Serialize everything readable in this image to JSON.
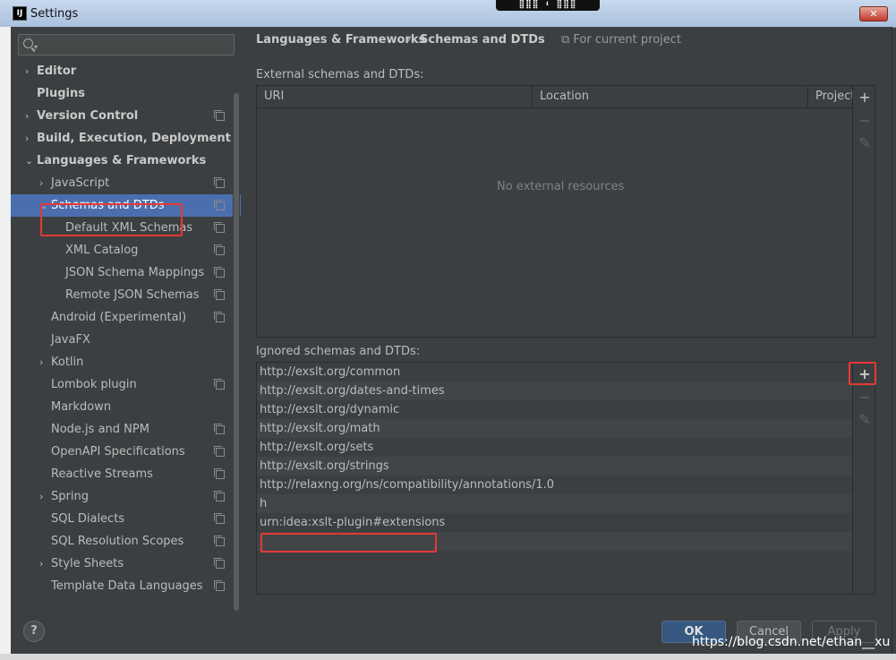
{
  "window": {
    "title": "Settings",
    "app_icon": "IJ",
    "close_label": "✕",
    "top_indicator": "⣿⣿⣿ ⬇ ⣿⣿⣿"
  },
  "sidebar": {
    "search_placeholder": "",
    "items": [
      {
        "label": "Editor",
        "level": 0,
        "arrow": "›",
        "bold": true,
        "project": false
      },
      {
        "label": "Plugins",
        "level": 0,
        "arrow": "",
        "bold": true,
        "project": false
      },
      {
        "label": "Version Control",
        "level": 0,
        "arrow": "›",
        "bold": true,
        "project": true
      },
      {
        "label": "Build, Execution, Deployment",
        "level": 0,
        "arrow": "›",
        "bold": true,
        "project": false
      },
      {
        "label": "Languages & Frameworks",
        "level": 0,
        "arrow": "⌄",
        "bold": true,
        "project": false
      },
      {
        "label": "JavaScript",
        "level": 1,
        "arrow": "›",
        "bold": false,
        "project": true
      },
      {
        "label": "Schemas and DTDs",
        "level": 1,
        "arrow": "⌄",
        "bold": false,
        "project": true,
        "selected": true
      },
      {
        "label": "Default XML Schemas",
        "level": 2,
        "arrow": "",
        "bold": false,
        "project": true
      },
      {
        "label": "XML Catalog",
        "level": 2,
        "arrow": "",
        "bold": false,
        "project": true
      },
      {
        "label": "JSON Schema Mappings",
        "level": 2,
        "arrow": "",
        "bold": false,
        "project": true
      },
      {
        "label": "Remote JSON Schemas",
        "level": 2,
        "arrow": "",
        "bold": false,
        "project": true
      },
      {
        "label": "Android (Experimental)",
        "level": 1,
        "arrow": "",
        "bold": false,
        "project": true
      },
      {
        "label": "JavaFX",
        "level": 1,
        "arrow": "",
        "bold": false,
        "project": false
      },
      {
        "label": "Kotlin",
        "level": 1,
        "arrow": "›",
        "bold": false,
        "project": false
      },
      {
        "label": "Lombok plugin",
        "level": 1,
        "arrow": "",
        "bold": false,
        "project": true
      },
      {
        "label": "Markdown",
        "level": 1,
        "arrow": "",
        "bold": false,
        "project": false
      },
      {
        "label": "Node.js and NPM",
        "level": 1,
        "arrow": "",
        "bold": false,
        "project": true
      },
      {
        "label": "OpenAPI Specifications",
        "level": 1,
        "arrow": "",
        "bold": false,
        "project": true
      },
      {
        "label": "Reactive Streams",
        "level": 1,
        "arrow": "",
        "bold": false,
        "project": true
      },
      {
        "label": "Spring",
        "level": 1,
        "arrow": "›",
        "bold": false,
        "project": true
      },
      {
        "label": "SQL Dialects",
        "level": 1,
        "arrow": "",
        "bold": false,
        "project": true
      },
      {
        "label": "SQL Resolution Scopes",
        "level": 1,
        "arrow": "",
        "bold": false,
        "project": true
      },
      {
        "label": "Style Sheets",
        "level": 1,
        "arrow": "›",
        "bold": false,
        "project": true
      },
      {
        "label": "Template Data Languages",
        "level": 1,
        "arrow": "",
        "bold": false,
        "project": true
      }
    ]
  },
  "main": {
    "breadcrumb_first": "Languages & Frameworks",
    "breadcrumb_sep": "›",
    "breadcrumb_second": "Schemas and DTDs",
    "scope_note": "⧉ For current project",
    "external": {
      "label": "External schemas and DTDs:",
      "columns": [
        "URI",
        "Location",
        "Project"
      ],
      "empty_message": "No external resources"
    },
    "ignored": {
      "label": "Ignored schemas and DTDs:",
      "rows": [
        "http://exslt.org/common",
        "http://exslt.org/dates-and-times",
        "http://exslt.org/dynamic",
        "http://exslt.org/math",
        "http://exslt.org/sets",
        "http://exslt.org/strings",
        "http://relaxng.org/ns/compatibility/annotations/1.0",
        "h              ",
        "urn:idea:xslt-plugin#extensions",
        ""
      ]
    },
    "tools": {
      "add": "+",
      "remove": "−",
      "edit": "✎"
    }
  },
  "footer": {
    "help": "?",
    "ok": "OK",
    "cancel": "Cancel",
    "apply": "Apply",
    "watermark": "https://blog.csdn.net/ethan__xu"
  },
  "colors": {
    "selection": "#4b6eaf",
    "annotation_red": "#e53935",
    "ok_button": "#365880"
  }
}
